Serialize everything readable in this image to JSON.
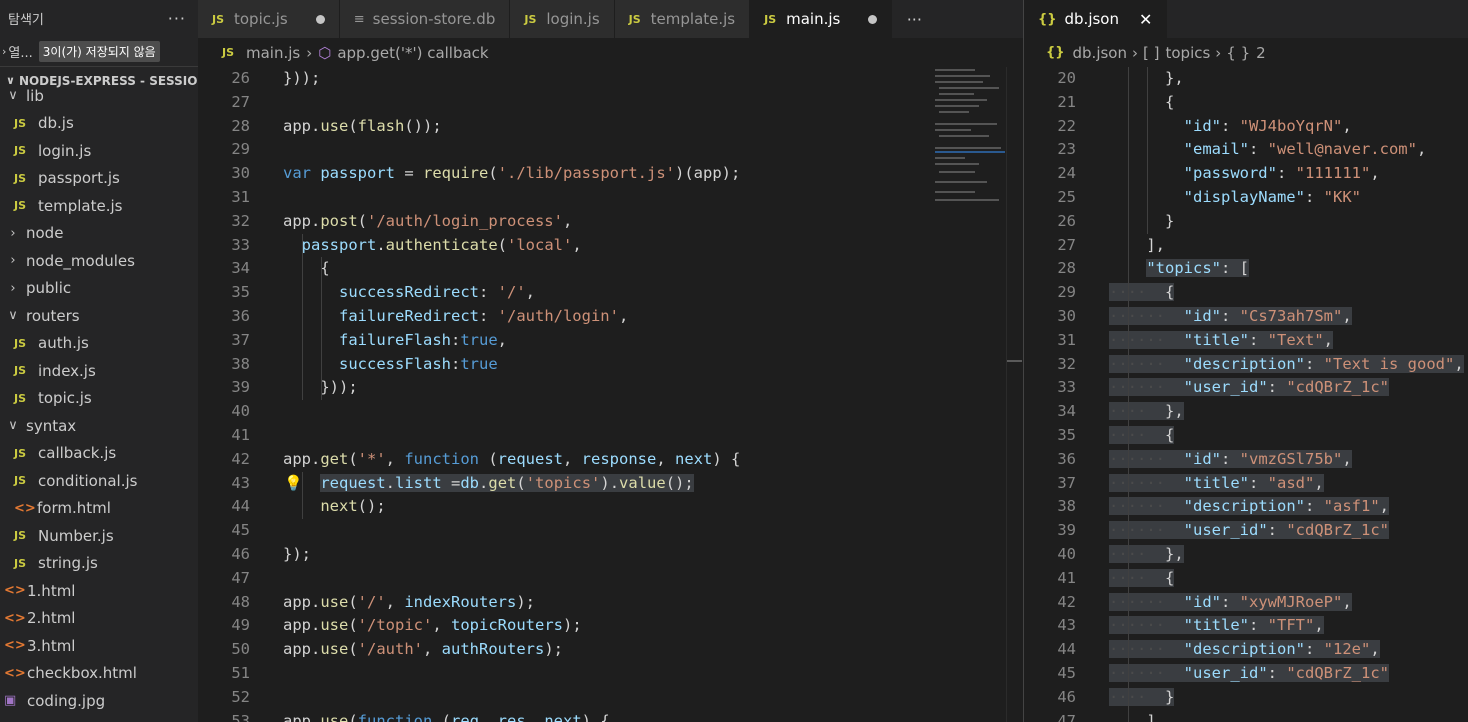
{
  "sidebar": {
    "title": "탐색기",
    "more": "···",
    "open_editors_label": "열...",
    "unsaved_badge": "3이(가) 저장되지 않음",
    "project": "NODEJS-EXPRESS - SESSIO...",
    "tree": [
      {
        "type": "folder-open",
        "label": "lib"
      },
      {
        "type": "js",
        "label": "db.js"
      },
      {
        "type": "js",
        "label": "login.js"
      },
      {
        "type": "js",
        "label": "passport.js"
      },
      {
        "type": "js",
        "label": "template.js"
      },
      {
        "type": "folder",
        "label": "node"
      },
      {
        "type": "folder",
        "label": "node_modules"
      },
      {
        "type": "folder",
        "label": "public"
      },
      {
        "type": "folder-open",
        "label": "routers"
      },
      {
        "type": "js",
        "label": "auth.js"
      },
      {
        "type": "js",
        "label": "index.js"
      },
      {
        "type": "js",
        "label": "topic.js"
      },
      {
        "type": "folder-open",
        "label": "syntax"
      },
      {
        "type": "js",
        "label": "callback.js"
      },
      {
        "type": "js",
        "label": "conditional.js"
      },
      {
        "type": "html",
        "label": "form.html"
      },
      {
        "type": "js",
        "label": "Number.js"
      },
      {
        "type": "js",
        "label": "string.js"
      },
      {
        "type": "html-root",
        "label": "1.html"
      },
      {
        "type": "html-root",
        "label": "2.html"
      },
      {
        "type": "html-root",
        "label": "3.html"
      },
      {
        "type": "html-root",
        "label": "checkbox.html"
      },
      {
        "type": "img-root",
        "label": "coding.jpg"
      }
    ]
  },
  "tabs": [
    {
      "label": "topic.js",
      "icon": "JS",
      "dirty": true,
      "active": false
    },
    {
      "label": "session-store.db",
      "icon": "lines",
      "dirty": false,
      "active": false
    },
    {
      "label": "login.js",
      "icon": "JS",
      "dirty": false,
      "active": false
    },
    {
      "label": "template.js",
      "icon": "JS",
      "dirty": false,
      "active": false
    },
    {
      "label": "main.js",
      "icon": "JS",
      "dirty": true,
      "active": true
    }
  ],
  "tabs_more": "···",
  "breadcrumb": {
    "file": "main.js",
    "symbol": "app.get('*') callback"
  },
  "main_code": [
    {
      "n": "26",
      "html": "<span class='pl'>}));</span>"
    },
    {
      "n": "27",
      "html": ""
    },
    {
      "n": "28",
      "html": "<span class='pl'>app.</span><span class='fn'>use</span><span class='pl'>(</span><span class='fn'>flash</span><span class='pl'>());</span>"
    },
    {
      "n": "29",
      "html": ""
    },
    {
      "n": "30",
      "html": "<span class='kw'>var</span> <span class='var'>passport</span> <span class='pl'>= </span><span class='fn'>require</span><span class='pl'>(</span><span class='str'>'./lib/passport.js'</span><span class='pl'>)(app);</span>"
    },
    {
      "n": "31",
      "html": ""
    },
    {
      "n": "32",
      "html": "<span class='pl'>app.</span><span class='fn'>post</span><span class='pl'>(</span><span class='str'>'/auth/login_process'</span><span class='pl'>,</span>"
    },
    {
      "n": "33",
      "html": "  <span class='var'>passport</span><span class='pl'>.</span><span class='fn'>authenticate</span><span class='pl'>(</span><span class='str'>'local'</span><span class='pl'>,</span>"
    },
    {
      "n": "34",
      "html": "    <span class='pl'>{</span>"
    },
    {
      "n": "35",
      "html": "      <span class='var'>successRedirect</span><span class='pl'>: </span><span class='str'>'/'</span><span class='pl'>,</span>"
    },
    {
      "n": "36",
      "html": "      <span class='var'>failureRedirect</span><span class='pl'>: </span><span class='str'>'/auth/login'</span><span class='pl'>,</span>"
    },
    {
      "n": "37",
      "html": "      <span class='var'>failureFlash</span><span class='pl'>:</span><span class='kw'>true</span><span class='pl'>,</span>"
    },
    {
      "n": "38",
      "html": "      <span class='var'>successFlash</span><span class='pl'>:</span><span class='kw'>true</span>"
    },
    {
      "n": "39",
      "html": "    <span class='pl'>}));</span>"
    },
    {
      "n": "40",
      "html": ""
    },
    {
      "n": "41",
      "html": ""
    },
    {
      "n": "42",
      "html": "<span class='pl'>app.</span><span class='fn'>get</span><span class='pl'>(</span><span class='str'>'*'</span><span class='pl'>, </span><span class='kw'>function</span><span class='pl'> (</span><span class='var'>request</span><span class='pl'>, </span><span class='var'>response</span><span class='pl'>, </span><span class='var'>next</span><span class='pl'>) {</span>"
    },
    {
      "n": "43",
      "html": "    <span class='sel'><span class='var'>request</span><span class='pl'>.</span><span class='var'>listt</span><span class='pl'> =</span><span class='var'>db</span><span class='pl'>.</span><span class='fn'>get</span><span class='pl'>(</span><span class='str'>'topics'</span><span class='pl'>).</span><span class='fn'>value</span><span class='pl'>();</span></span>"
    },
    {
      "n": "44",
      "html": "    <span class='fn'>next</span><span class='pl'>();</span>"
    },
    {
      "n": "45",
      "html": ""
    },
    {
      "n": "46",
      "html": "<span class='pl'>});</span>"
    },
    {
      "n": "47",
      "html": ""
    },
    {
      "n": "48",
      "html": "<span class='pl'>app.</span><span class='fn'>use</span><span class='pl'>(</span><span class='str'>'/'</span><span class='pl'>, </span><span class='var'>indexRouters</span><span class='pl'>);</span>"
    },
    {
      "n": "49",
      "html": "<span class='pl'>app.</span><span class='fn'>use</span><span class='pl'>(</span><span class='str'>'/topic'</span><span class='pl'>, </span><span class='var'>topicRouters</span><span class='pl'>);</span>"
    },
    {
      "n": "50",
      "html": "<span class='pl'>app.</span><span class='fn'>use</span><span class='pl'>(</span><span class='str'>'/auth'</span><span class='pl'>, </span><span class='var'>authRouters</span><span class='pl'>);</span>"
    },
    {
      "n": "51",
      "html": ""
    },
    {
      "n": "52",
      "html": ""
    },
    {
      "n": "53",
      "html": "<span class='pl'>app.</span><span class='fn'>use</span><span class='pl'>(</span><span class='kw'>function</span><span class='pl'> (</span><span class='var'>req</span><span class='pl'>, </span><span class='var'>res</span><span class='pl'>, </span><span class='var'>next</span><span class='pl'>) {</span>"
    }
  ],
  "right_tab": {
    "label": "db.json",
    "icon": "{}",
    "close": "✕"
  },
  "right_breadcrumb": {
    "file": "db.json",
    "array": "topics",
    "index": "2"
  },
  "json_code": [
    {
      "n": "20",
      "html": "      <span class='pl'>},</span>",
      "sel": false
    },
    {
      "n": "21",
      "html": "      <span class='pl'>{</span>",
      "sel": false
    },
    {
      "n": "22",
      "html": "        <span class='key'>\"id\"</span><span class='pl'>: </span><span class='str'>\"WJ4boYqrN\"</span><span class='pl'>,</span>",
      "sel": false
    },
    {
      "n": "23",
      "html": "        <span class='key'>\"email\"</span><span class='pl'>: </span><span class='str'>\"well@naver.com\"</span><span class='pl'>,</span>",
      "sel": false
    },
    {
      "n": "24",
      "html": "        <span class='key'>\"password\"</span><span class='pl'>: </span><span class='str'>\"111111\"</span><span class='pl'>,</span>",
      "sel": false
    },
    {
      "n": "25",
      "html": "        <span class='key'>\"displayName\"</span><span class='pl'>: </span><span class='str'>\"KK\"</span>",
      "sel": false
    },
    {
      "n": "26",
      "html": "      <span class='pl'>}</span>",
      "sel": false
    },
    {
      "n": "27",
      "html": "    <span class='pl'>],</span>",
      "sel": false
    },
    {
      "n": "28",
      "html": "    <span class='jsel'><span class='key'>\"topics\"</span><span class='pl'>: [</span></span>",
      "sel": true
    },
    {
      "n": "29",
      "html": "<span class='jsel'><span class='ws'>····</span>  <span class='pl'>{</span></span>",
      "sel": true
    },
    {
      "n": "30",
      "html": "<span class='jsel'><span class='ws'>······</span>  <span class='key'>\"id\"</span><span class='pl'>: </span><span class='str'>\"Cs73ah7Sm\"</span><span class='pl'>,</span></span>",
      "sel": true
    },
    {
      "n": "31",
      "html": "<span class='jsel'><span class='ws'>······</span>  <span class='key'>\"title\"</span><span class='pl'>: </span><span class='str'>\"Text\"</span><span class='pl'>,</span></span>",
      "sel": true
    },
    {
      "n": "32",
      "html": "<span class='jsel'><span class='ws'>······</span>  <span class='key'>\"description\"</span><span class='pl'>: </span><span class='str'>\"Text is good\"</span><span class='pl'>,</span></span>",
      "sel": true
    },
    {
      "n": "33",
      "html": "<span class='jsel'><span class='ws'>······</span>  <span class='key'>\"user_id\"</span><span class='pl'>: </span><span class='str'>\"cdQBrZ_1c\"</span></span>",
      "sel": true
    },
    {
      "n": "34",
      "html": "<span class='jsel'><span class='ws'>····</span>  <span class='pl'>},</span></span>",
      "sel": true
    },
    {
      "n": "35",
      "html": "<span class='jsel'><span class='ws'>····</span>  <span class='pl'>{</span></span>",
      "sel": true
    },
    {
      "n": "36",
      "html": "<span class='jsel'><span class='ws'>······</span>  <span class='key'>\"id\"</span><span class='pl'>: </span><span class='str'>\"vmzGSl75b\"</span><span class='pl'>,</span></span>",
      "sel": true
    },
    {
      "n": "37",
      "html": "<span class='jsel'><span class='ws'>······</span>  <span class='key'>\"title\"</span><span class='pl'>: </span><span class='str'>\"asd\"</span><span class='pl'>,</span></span>",
      "sel": true
    },
    {
      "n": "38",
      "html": "<span class='jsel'><span class='ws'>······</span>  <span class='key'>\"description\"</span><span class='pl'>: </span><span class='str'>\"asf1\"</span><span class='pl'>,</span></span>",
      "sel": true
    },
    {
      "n": "39",
      "html": "<span class='jsel'><span class='ws'>······</span>  <span class='key'>\"user_id\"</span><span class='pl'>: </span><span class='str'>\"cdQBrZ_1c\"</span></span>",
      "sel": true
    },
    {
      "n": "40",
      "html": "<span class='jsel'><span class='ws'>····</span>  <span class='pl'>},</span></span>",
      "sel": true
    },
    {
      "n": "41",
      "html": "<span class='jsel'><span class='ws'>····</span>  <span class='pl'>{</span></span>",
      "sel": true
    },
    {
      "n": "42",
      "html": "<span class='jsel'><span class='ws'>······</span>  <span class='key'>\"id\"</span><span class='pl'>: </span><span class='str'>\"xywMJRoeP\"</span><span class='pl'>,</span></span>",
      "sel": true
    },
    {
      "n": "43",
      "html": "<span class='jsel'><span class='ws'>······</span>  <span class='key'>\"title\"</span><span class='pl'>: </span><span class='str'>\"TFT\"</span><span class='pl'>,</span></span>",
      "sel": true
    },
    {
      "n": "44",
      "html": "<span class='jsel'><span class='ws'>······</span>  <span class='key'>\"description\"</span><span class='pl'>: </span><span class='str'>\"12e\"</span><span class='pl'>,</span></span>",
      "sel": true
    },
    {
      "n": "45",
      "html": "<span class='jsel'><span class='ws'>······</span>  <span class='key'>\"user_id\"</span><span class='pl'>: </span><span class='str'>\"cdQBrZ_1c\"</span></span>",
      "sel": true
    },
    {
      "n": "46",
      "html": "<span class='jsel'><span class='ws'>····</span>  <span class='pl'>}</span></span>",
      "sel": true
    },
    {
      "n": "47",
      "html": "    <span class='pl'>]</span>",
      "sel": false
    }
  ],
  "colors": {
    "accent": "#007acc",
    "editor_bg": "#1e1e1e",
    "sidebar_bg": "#252526"
  }
}
